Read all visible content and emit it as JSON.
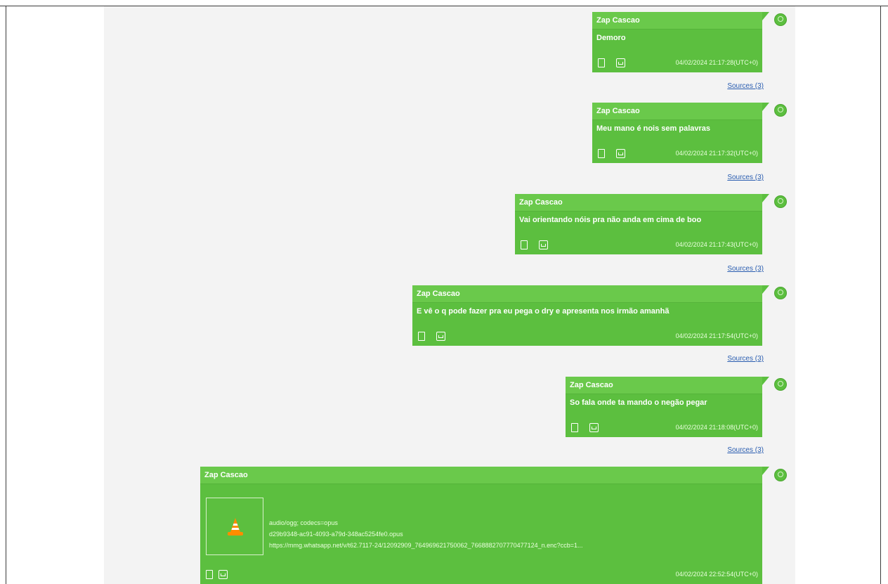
{
  "messages": [
    {
      "sender": "Zap Cascao",
      "text": "Demoro",
      "timestamp": "04/02/2024 21:17:28(UTC+0)",
      "sources": "Sources (3)"
    },
    {
      "sender": "Zap Cascao",
      "text": "Meu mano é nois sem palavras",
      "timestamp": "04/02/2024 21:17:32(UTC+0)",
      "sources": "Sources (3)"
    },
    {
      "sender": "Zap Cascao",
      "text": "Vai orientando nóis pra não anda em cima de boo",
      "timestamp": "04/02/2024 21:17:43(UTC+0)",
      "sources": "Sources (3)"
    },
    {
      "sender": "Zap Cascao",
      "text": "E vê o q pode fazer pra eu pega o dry e apresenta nos irmão amanhã",
      "timestamp": "04/02/2024 21:17:54(UTC+0)",
      "sources": "Sources (3)"
    },
    {
      "sender": "Zap Cascao",
      "text": "So fala onde ta mando o negão pegar",
      "timestamp": "04/02/2024 21:18:08(UTC+0)",
      "sources": "Sources (3)"
    },
    {
      "sender": "Zap Cascao",
      "timestamp": "04/02/2024 22:52:54(UTC+0)",
      "attachment": {
        "mime": "audio/ogg; codecs=opus",
        "filename": "d29b9348-ac91-4093-a79d-348ac5254fe0.opus",
        "url": "https://mmg.whatsapp.net/v/t62.7117-24/12092909_764969621750062_7668882707770477124_n.enc?ccb=1..."
      }
    }
  ],
  "icons": {
    "device": "phone-icon",
    "status": "message-status-icon",
    "avatar": "avatar-icon",
    "media": "vlc-cone-icon"
  },
  "colors": {
    "bubble": "#5cbf3f",
    "header": "#6ac94b",
    "link": "#2a5db0",
    "panel": "#f3f3f3"
  }
}
